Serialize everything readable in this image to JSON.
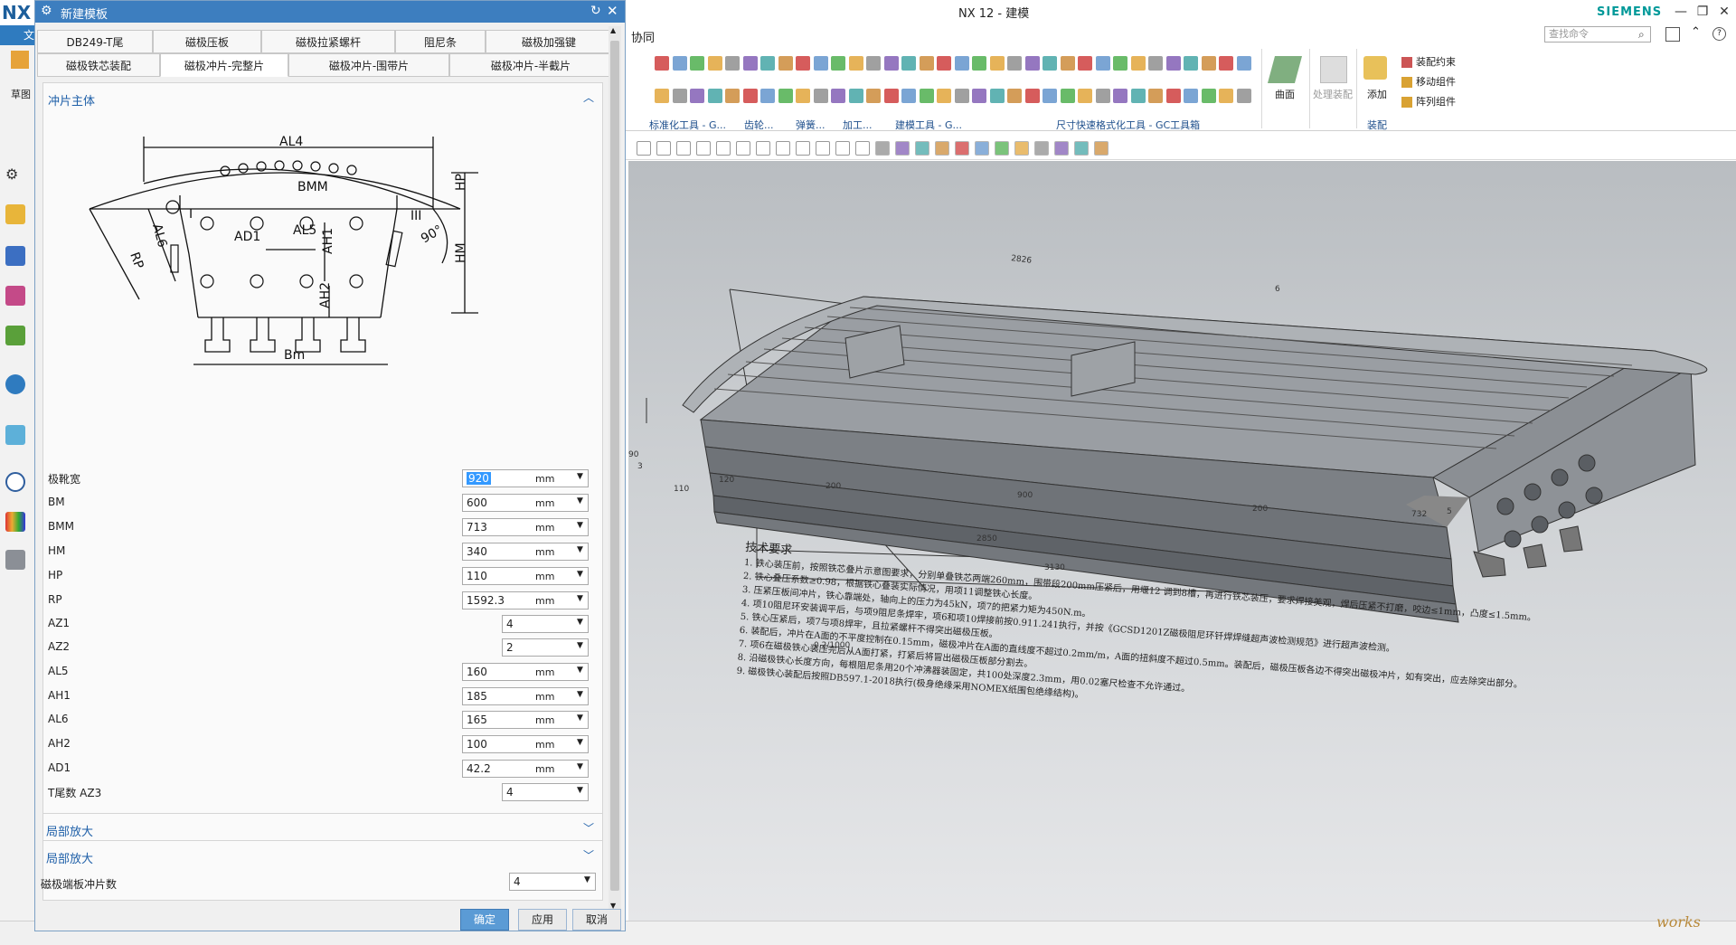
{
  "app": {
    "window_title": "NX 12 - 建模",
    "brand": "SIEMENS",
    "logo": "NX",
    "file_tab": "文",
    "menu_partial": "协同",
    "search_placeholder": "查找命令",
    "left_label_sketch": "草图"
  },
  "ribbon": {
    "groups": [
      {
        "label": "标准化工具 - G..."
      },
      {
        "label": "齿轮..."
      },
      {
        "label": "弹簧..."
      },
      {
        "label": "加工..."
      },
      {
        "label": "建模工具 - G..."
      },
      {
        "label": "尺寸快速格式化工具 - GC工具箱"
      },
      {
        "label": "装配"
      }
    ],
    "surface_label": "曲面",
    "process_label": "处理装配",
    "add_label": "添加",
    "assembly_items": [
      "装配约束",
      "移动组件",
      "阵列组件"
    ]
  },
  "dialog": {
    "title": "新建模板",
    "tabs_row1": [
      "DB249-T尾",
      "磁极压板",
      "磁极拉紧螺杆",
      "阻尼条",
      "磁极加强键"
    ],
    "tabs_row2": [
      "磁极铁芯装配",
      "磁极冲片-完整片",
      "磁极冲片-围带片",
      "磁极冲片-半截片"
    ],
    "active_tab": "磁极冲片-完整片",
    "section_main": "冲片主体",
    "params": [
      {
        "label": "极靴宽",
        "value": "920",
        "unit": "mm"
      },
      {
        "label": "BM",
        "value": "600",
        "unit": "mm"
      },
      {
        "label": "BMM",
        "value": "713",
        "unit": "mm"
      },
      {
        "label": "HM",
        "value": "340",
        "unit": "mm"
      },
      {
        "label": "HP",
        "value": "110",
        "unit": "mm"
      },
      {
        "label": "RP",
        "value": "1592.3",
        "unit": "mm"
      },
      {
        "label": "AZ1",
        "value": "4",
        "unit": ""
      },
      {
        "label": "AZ2",
        "value": "2",
        "unit": ""
      },
      {
        "label": "AL5",
        "value": "160",
        "unit": "mm"
      },
      {
        "label": "AH1",
        "value": "185",
        "unit": "mm"
      },
      {
        "label": "AL6",
        "value": "165",
        "unit": "mm"
      },
      {
        "label": "AH2",
        "value": "100",
        "unit": "mm"
      },
      {
        "label": "AD1",
        "value": "42.2",
        "unit": "mm"
      },
      {
        "label": "T尾数 AZ3",
        "value": "4",
        "unit": ""
      }
    ],
    "section_zoom1": "局部放大",
    "section_zoom2": "局部放大",
    "end_plate_label": "磁极端板冲片数",
    "end_plate_value": "4",
    "ok": "确定",
    "apply": "应用",
    "cancel": "取消"
  },
  "sketch_labels": {
    "al4": "AL4",
    "bmm": "BMM",
    "hp": "HP",
    "hm": "HM",
    "al6": "AL6",
    "rp": "RP",
    "ad1": "AD1",
    "al5": "AL5",
    "ah1": "AH1",
    "ah2": "AH2",
    "bm": "Bm",
    "roman1": "I",
    "roman3": "III",
    "angle": "90°"
  },
  "drawing": {
    "dims": [
      "2826",
      "6",
      "90",
      "3",
      "120",
      "110",
      "200",
      "900",
      "200",
      "732",
      "5",
      "2850",
      "3130",
      "0.2/1000"
    ],
    "notes_title": "技术要求",
    "notes": [
      "1. 铁心装压前，按照铁芯叠片示意图要求，分别单叠铁芯两端260mm，围带段200mm压紧后，用堰12  调到8槽，再进行铁芯装压，要求焊接美观，焊后压紧不打磨，咬边≤1mm，凸度≤1.5mm。",
      "2. 铁心叠压系数≥0.98，根据铁心叠装实际情况，用项11调整铁心长度。",
      "3. 压紧压板间冲片，铁心靠端处，轴向上的压力为45kN，项7的把紧力矩为450N.m。",
      "4. 项10阻尼环安装调平后，与项9阻尼条焊牢，项6和项10焊接前按0.911.241执行，并按《GCSD1201Z磁极阻尼环钎焊焊缝超声波检测规范》进行超声波检测。",
      "5. 铁心压紧后，项7与项8焊牢，且拉紧螺杆不得突出磁极压板。",
      "6. 装配后，冲片在A面的不平度控制在0.15mm，磁极冲片在A面的直线度不超过0.2mm/m，A面的扭斜度不超过0.5mm。装配后，磁极压板各边不得突出磁极冲片，如有突出，应去除突出部分。",
      "7. 项6在磁极铁心装压完后从A面打紧，打紧后将冒出磁极压板部分割去。",
      "8. 沿磁极铁心长度方向，每根阻尼条用20个冲沸器装固定，共100处深度2.3mm，用0.02塞尺检查不允许通过。",
      "9. 磁极铁心装配后按照DB597.1-2018执行(极身绝缘采用NOMEX纸围包绝缘结构)。"
    ]
  },
  "watermark": "works",
  "colors": {
    "accent": "#3d7ebf",
    "brand": "#009999",
    "viewport_bg": "#c8cbce"
  }
}
